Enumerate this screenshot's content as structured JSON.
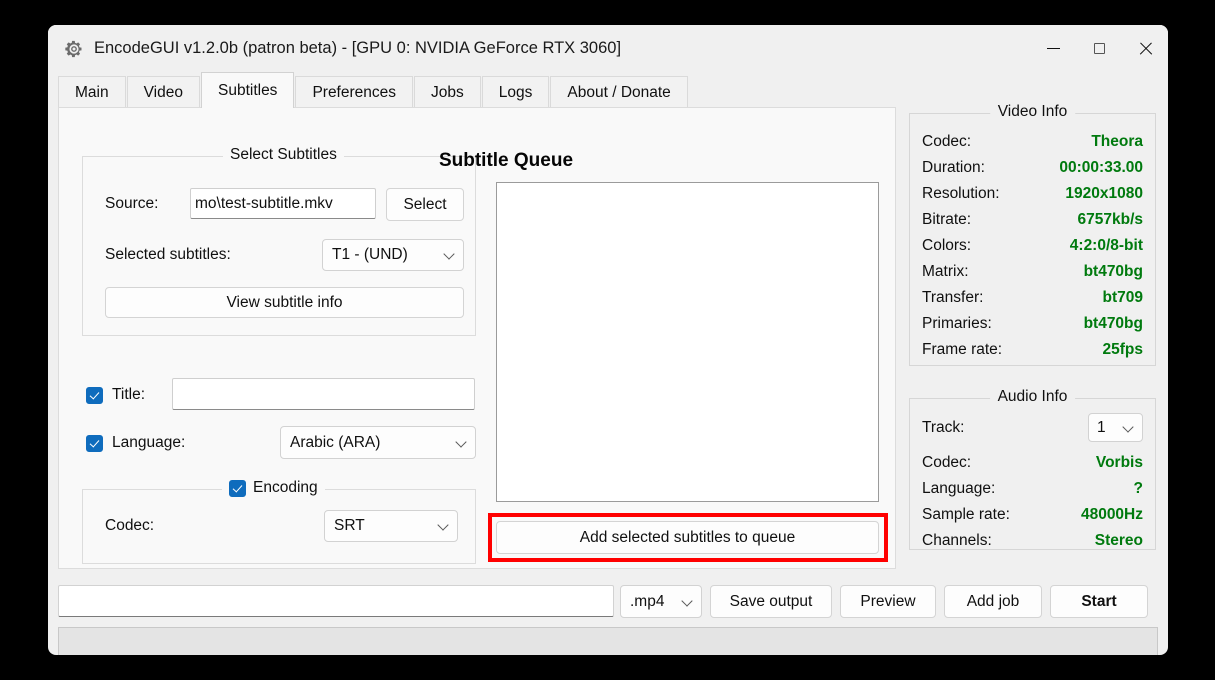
{
  "window": {
    "title": "EncodeGUI v1.2.0b (patron beta) - [GPU 0: NVIDIA GeForce RTX 3060]",
    "icon": "gear-icon",
    "controls": {
      "minimize": "—",
      "maximize": "□",
      "close": "×"
    }
  },
  "tabs": [
    {
      "label": "Main",
      "active": false
    },
    {
      "label": "Video",
      "active": false
    },
    {
      "label": "Subtitles",
      "active": true
    },
    {
      "label": "Preferences",
      "active": false
    },
    {
      "label": "Jobs",
      "active": false
    },
    {
      "label": "Logs",
      "active": false
    },
    {
      "label": "About / Donate",
      "active": false
    }
  ],
  "select_subtitles": {
    "group_title": "Select Subtitles",
    "source_label": "Source:",
    "source_value": "mo\\test-subtitle.mkv",
    "select_button": "Select",
    "selected_label": "Selected subtitles:",
    "selected_value": "T1 - (UND)",
    "view_info_button": "View subtitle info"
  },
  "options": {
    "title_label": "Title:",
    "title_value": "",
    "title_checked": true,
    "language_label": "Language:",
    "language_value": "Arabic (ARA)",
    "language_checked": true,
    "encoding_label": "Encoding",
    "encoding_checked": true,
    "codec_label": "Codec:",
    "codec_value": "SRT"
  },
  "queue": {
    "title": "Subtitle Queue",
    "items": [],
    "add_button": "Add selected subtitles to queue",
    "highlight_color": "#FF0000"
  },
  "video_info": {
    "title": "Video Info",
    "value_color": "#007A0E",
    "rows": [
      {
        "key": "Codec:",
        "value": "Theora"
      },
      {
        "key": "Duration:",
        "value": "00:00:33.00"
      },
      {
        "key": "Resolution:",
        "value": "1920x1080"
      },
      {
        "key": "Bitrate:",
        "value": "6757kb/s"
      },
      {
        "key": "Colors:",
        "value": "4:2:0/8-bit"
      },
      {
        "key": "Matrix:",
        "value": "bt470bg"
      },
      {
        "key": "Transfer:",
        "value": "bt709"
      },
      {
        "key": "Primaries:",
        "value": "bt470bg"
      },
      {
        "key": "Frame rate:",
        "value": "25fps"
      }
    ]
  },
  "audio_info": {
    "title": "Audio Info",
    "track_label": "Track:",
    "track_value": "1",
    "rows": [
      {
        "key": "Codec:",
        "value": "Vorbis"
      },
      {
        "key": "Language:",
        "value": "?"
      },
      {
        "key": "Sample rate:",
        "value": "48000Hz"
      },
      {
        "key": "Channels:",
        "value": "Stereo"
      }
    ]
  },
  "bottom_bar": {
    "output_value": "",
    "container_value": ".mp4",
    "save_output_button": "Save output",
    "preview_button": "Preview",
    "add_job_button": "Add job",
    "start_button": "Start"
  },
  "status_bar": {
    "text": ""
  }
}
